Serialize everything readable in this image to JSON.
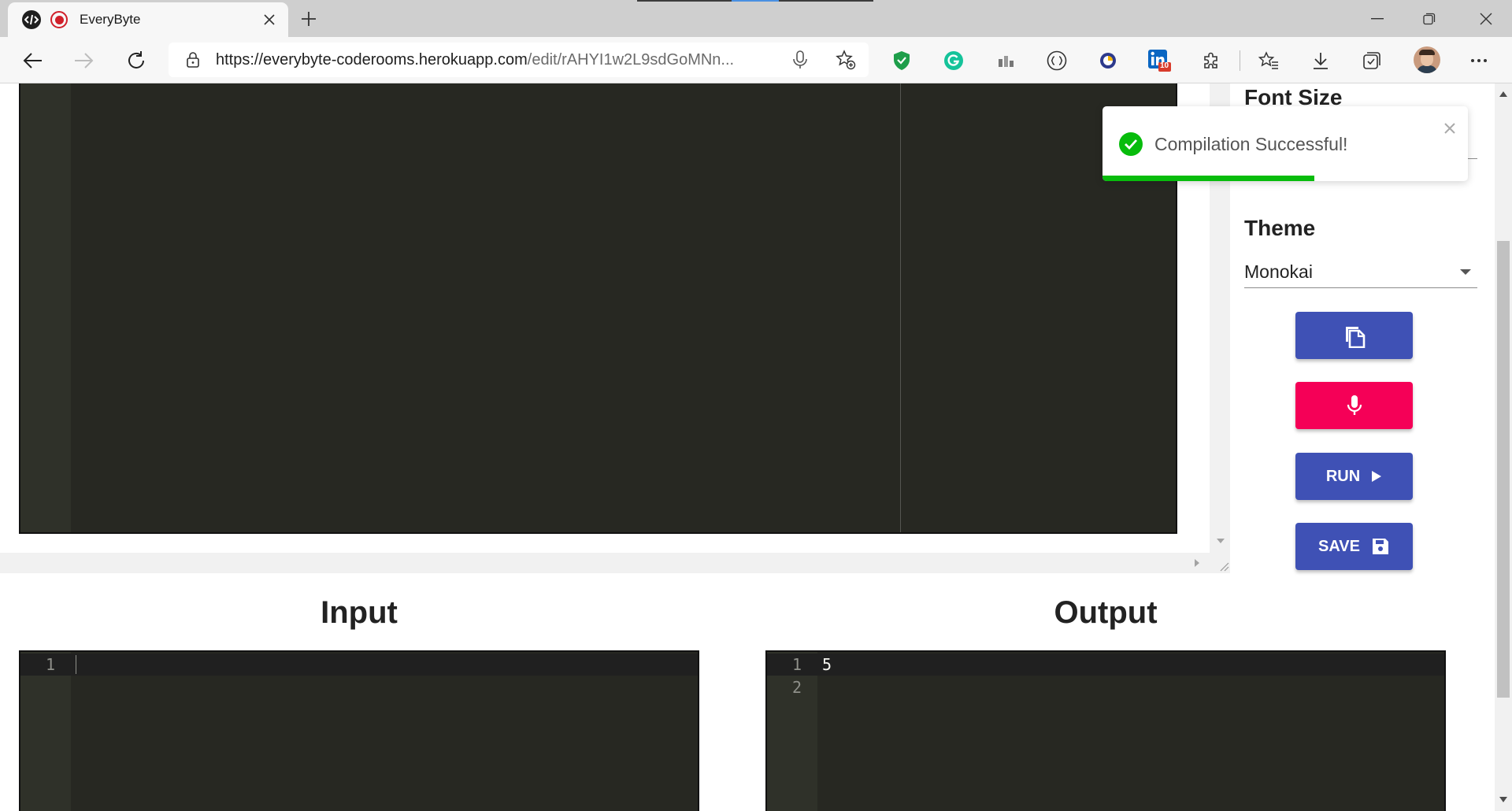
{
  "browser": {
    "tab": {
      "title": "EveryByte"
    },
    "url": {
      "host": "https://everybyte-coderooms.herokuapp.com",
      "path": "/edit/rAHYI1w2L9sdGoMNn..."
    },
    "extensions": [
      "shield-icon",
      "grammarly-icon",
      "chart-icon",
      "bracket-icon",
      "circle-app-icon",
      "linkedin-icon",
      "puzzle-icon"
    ],
    "linkedin_badge": "10"
  },
  "side_panel": {
    "font_size_label": "Font Size",
    "theme_label": "Theme",
    "theme_value": "Monokai",
    "run_label": "RUN",
    "save_label": "SAVE",
    "copy_color": "#3f51b5",
    "mic_color": "#f50057",
    "run_color": "#3f51b5",
    "save_color": "#3f51b5"
  },
  "toast": {
    "message": "Compilation Successful!",
    "progress": 0.58,
    "color": "#07bc0c"
  },
  "input_panel": {
    "title": "Input",
    "line_numbers": [
      "1"
    ],
    "lines": [
      ""
    ]
  },
  "output_panel": {
    "title": "Output",
    "line_numbers": [
      "1",
      "2"
    ],
    "lines": [
      "5",
      ""
    ]
  }
}
